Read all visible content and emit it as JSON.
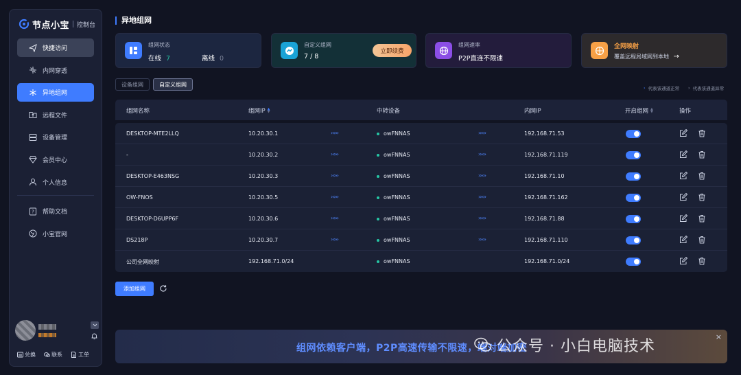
{
  "app": {
    "name": "节点小宝",
    "subtitle": "控制台"
  },
  "sidebar": {
    "items": [
      {
        "label": "快捷访问",
        "icon": "send-icon"
      },
      {
        "label": "内网穿透",
        "icon": "network-icon"
      },
      {
        "label": "异地组网",
        "icon": "mesh-icon"
      },
      {
        "label": "远程文件",
        "icon": "folder-icon"
      },
      {
        "label": "设备管理",
        "icon": "device-icon"
      },
      {
        "label": "会员中心",
        "icon": "diamond-icon"
      },
      {
        "label": "个人信息",
        "icon": "user-icon"
      },
      {
        "label": "帮助文档",
        "icon": "help-icon"
      },
      {
        "label": "小宝官网",
        "icon": "globe-icon"
      }
    ],
    "active": "异地组网",
    "user_links": [
      {
        "label": "兑换",
        "icon": "exchange-icon"
      },
      {
        "label": "联系",
        "icon": "chat-icon"
      },
      {
        "label": "工单",
        "icon": "ticket-icon"
      }
    ]
  },
  "page": {
    "title": "异地组网"
  },
  "cards": {
    "status": {
      "label": "组网状态",
      "online_label": "在线",
      "online": "7",
      "offline_label": "离线",
      "offline": "0"
    },
    "custom": {
      "label": "自定义组网",
      "value": "7 / 8",
      "button": "立即续费"
    },
    "speed": {
      "label": "组网速率",
      "value": "P2P直连不限速"
    },
    "mapping": {
      "label": "全网映射",
      "value": "覆盖远程局域网到本地"
    }
  },
  "tabs": [
    {
      "label": "设备组网",
      "active": false
    },
    {
      "label": "自定义组网",
      "active": true
    }
  ],
  "legend": {
    "normal": "代表该通道正常",
    "abnormal": "代表该通道异常"
  },
  "table": {
    "headers": {
      "name": "组网名称",
      "ip": "组网IP",
      "relay": "中转设备",
      "lan": "内网IP",
      "enabled": "开启组网",
      "actions": "操作"
    },
    "rows": [
      {
        "name": "DESKTOP-MTE2LLQ",
        "ip": "10.20.30.1",
        "relay": "owFNNAS",
        "lan": "192.168.71.53"
      },
      {
        "name": "-",
        "ip": "10.20.30.2",
        "relay": "owFNNAS",
        "lan": "192.168.71.119"
      },
      {
        "name": "DESKTOP-E463NSG",
        "ip": "10.20.30.3",
        "relay": "owFNNAS",
        "lan": "192.168.71.10"
      },
      {
        "name": "OW-FNOS",
        "ip": "10.20.30.5",
        "relay": "owFNNAS",
        "lan": "192.168.71.162"
      },
      {
        "name": "DESKTOP-D6UPP6F",
        "ip": "10.20.30.6",
        "relay": "owFNNAS",
        "lan": "192.168.71.88"
      },
      {
        "name": "DS218P",
        "ip": "10.20.30.7",
        "relay": "owFNNAS",
        "lan": "192.168.71.110"
      },
      {
        "name": "公司全网映射",
        "ip": "192.168.71.0/24",
        "relay": "owFNNAS",
        "lan": "192.168.71.0/24"
      }
    ],
    "arrows": "›››››"
  },
  "buttons": {
    "add": "添加组网"
  },
  "banner": {
    "text": "组网依赖客户端，P2P高速传输不限速，端对端加密",
    "close": "×"
  },
  "watermark": {
    "text": "公众号 · 小白电脑技术"
  },
  "colors": {
    "accent": "#3f7cff",
    "online": "#26c6a4",
    "mapping": "#f7a046"
  }
}
